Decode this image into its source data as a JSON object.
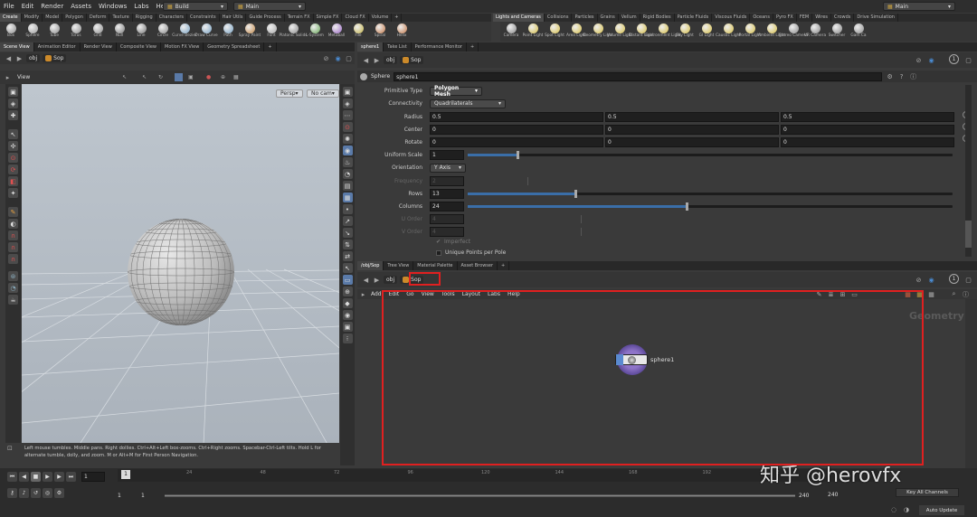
{
  "menubar": {
    "items": [
      "File",
      "Edit",
      "Render",
      "Assets",
      "Windows",
      "Labs",
      "Help"
    ],
    "build_dropdown": "Build",
    "main_dropdown": "Main",
    "main_dropdown_right": "Main"
  },
  "shelf_left": {
    "tabs": [
      "Create",
      "Modify",
      "Model",
      "Polygon",
      "Deform",
      "Texture",
      "Rigging",
      "Characters",
      "Constraints",
      "Hair Utils",
      "Guide Process",
      "Terrain FX",
      "Simple FX",
      "Cloud FX",
      "Volume",
      "+"
    ],
    "tools": [
      {
        "label": "Box",
        "icon": "box-icon",
        "color": "#8d8d8d"
      },
      {
        "label": "Sphere",
        "icon": "sphere-icon",
        "color": "#9c9c9c"
      },
      {
        "label": "Tube",
        "icon": "tube-icon",
        "color": "#8d8d8d"
      },
      {
        "label": "Torus",
        "icon": "torus-icon",
        "color": "#8d8d8d"
      },
      {
        "label": "Grid",
        "icon": "grid-icon",
        "color": "#8d8d8d"
      },
      {
        "label": "Null",
        "icon": "null-icon",
        "color": "#7a7a7a"
      },
      {
        "label": "Line",
        "icon": "line-icon",
        "color": "#7a7a7a"
      },
      {
        "label": "Circle",
        "icon": "circle-icon",
        "color": "#8d8d8d"
      },
      {
        "label": "Curve Bezier",
        "icon": "curve-bezier-icon",
        "color": "#7aa3c4"
      },
      {
        "label": "Draw Curve",
        "icon": "draw-curve-icon",
        "color": "#7aa3c4"
      },
      {
        "label": "Path",
        "icon": "path-icon",
        "color": "#7aa3c4"
      },
      {
        "label": "Spray Paint",
        "icon": "spray-paint-icon",
        "color": "#c48a4a"
      },
      {
        "label": "Font",
        "icon": "font-icon",
        "color": "#aaaaaa"
      },
      {
        "label": "Platonic Solids",
        "icon": "platonic-solids-icon",
        "color": "#8d8d8d"
      },
      {
        "label": "L-System",
        "icon": "l-system-icon",
        "color": "#6aa85a"
      },
      {
        "label": "Metaball",
        "icon": "metaball-icon",
        "color": "#9b6ac4"
      },
      {
        "label": "File",
        "icon": "file-icon",
        "color": "#c4b44a"
      },
      {
        "label": "Spiral",
        "icon": "spiral-icon",
        "color": "#c47a4a"
      },
      {
        "label": "Helix",
        "icon": "helix-icon",
        "color": "#c47a4a"
      }
    ]
  },
  "shelf_right": {
    "tabs": [
      "Lights and Cameras",
      "Collisions",
      "Particles",
      "Grains",
      "Vellum",
      "Rigid Bodies",
      "Particle Fluids",
      "Viscous Fluids",
      "Oceans",
      "Pyro FX",
      "FEM",
      "Wires",
      "Crowds",
      "Drive Simulation"
    ],
    "tools": [
      {
        "label": "Camera",
        "icon": "camera-icon",
        "color": "#8a8a8a"
      },
      {
        "label": "Point Light",
        "icon": "point-light-icon",
        "color": "#d8c04a"
      },
      {
        "label": "Spot Light",
        "icon": "spot-light-icon",
        "color": "#d8c04a"
      },
      {
        "label": "Area Light",
        "icon": "area-light-icon",
        "color": "#d8c04a"
      },
      {
        "label": "Geometry Light",
        "icon": "geometry-light-icon",
        "color": "#d8c04a"
      },
      {
        "label": "Volume Light",
        "icon": "volume-light-icon",
        "color": "#d8c04a"
      },
      {
        "label": "Distant Light",
        "icon": "distant-light-icon",
        "color": "#d8c04a"
      },
      {
        "label": "Environment Light",
        "icon": "environment-light-icon",
        "color": "#d8c04a"
      },
      {
        "label": "Sky Light",
        "icon": "sky-light-icon",
        "color": "#d8c04a"
      },
      {
        "label": "GI Light",
        "icon": "gi-light-icon",
        "color": "#d8c04a"
      },
      {
        "label": "Caustic Light",
        "icon": "caustic-light-icon",
        "color": "#d8c04a"
      },
      {
        "label": "Portal Light",
        "icon": "portal-light-icon",
        "color": "#d8c04a"
      },
      {
        "label": "Ambient Light",
        "icon": "ambient-light-icon",
        "color": "#d8c04a"
      },
      {
        "label": "Stereo Camera",
        "icon": "stereo-camera-icon",
        "color": "#8a8a8a"
      },
      {
        "label": "VR Camera",
        "icon": "vr-camera-icon",
        "color": "#8a8a8a"
      },
      {
        "label": "Switcher",
        "icon": "switcher-icon",
        "color": "#8a8a8a"
      },
      {
        "label": "Gam Ca",
        "icon": "gamepad-camera-icon",
        "color": "#8a8a8a"
      }
    ]
  },
  "left_pane": {
    "tabs": [
      "Scene View",
      "Animation Editor",
      "Render View",
      "Composite View",
      "Motion FX View",
      "Geometry Spreadsheet",
      "+"
    ],
    "path": {
      "root": "obj",
      "node": "Sop"
    },
    "view_label": "View",
    "persp": "Persp",
    "cam": "No cam",
    "hint": "Left mouse tumbles. Middle pans. Right dollies. Ctrl+Alt+Left box-zooms. Ctrl+Right zooms. Spacebar-Ctrl-Left tilts. Hold L for alternate tumble, dolly, and zoom.    M or Alt+M for First Person Navigation."
  },
  "param_pane": {
    "tabs": [
      "sphere1",
      "Take List",
      "Performance Monitor",
      "+"
    ],
    "path": {
      "root": "obj",
      "node": "Sop"
    },
    "node_type": "Sphere",
    "node_name": "sphere1",
    "params": {
      "primitive_type": {
        "label": "Primitive Type",
        "value": "Polygon Mesh"
      },
      "connectivity": {
        "label": "Connectivity",
        "value": "Quadrilaterals"
      },
      "radius": {
        "label": "Radius",
        "values": [
          "0.5",
          "0.5",
          "0.5"
        ]
      },
      "center": {
        "label": "Center",
        "values": [
          "0",
          "0",
          "0"
        ]
      },
      "rotate": {
        "label": "Rotate",
        "values": [
          "0",
          "0",
          "0"
        ]
      },
      "uniform_scale": {
        "label": "Uniform Scale",
        "value": "1",
        "fraction": 0.1
      },
      "orientation": {
        "label": "Orientation",
        "value": "Y Axis"
      },
      "frequency": {
        "label": "Frequency",
        "value": "2"
      },
      "rows": {
        "label": "Rows",
        "value": "13",
        "fraction": 0.22
      },
      "columns": {
        "label": "Columns",
        "value": "24",
        "fraction": 0.45
      },
      "u_order": {
        "label": "U Order",
        "value": "4"
      },
      "v_order": {
        "label": "V Order",
        "value": "4"
      },
      "imperfect": {
        "label": "Imperfect"
      },
      "unique_points": {
        "label": "Unique Points per Pole"
      }
    }
  },
  "network_pane": {
    "tabs": [
      "/obj/Sop",
      "Tree View",
      "Material Palette",
      "Asset Browser",
      "+"
    ],
    "path": {
      "root": "obj",
      "node": "Sop"
    },
    "menu": [
      "Add",
      "Edit",
      "Go",
      "View",
      "Tools",
      "Layout",
      "Labs",
      "Help"
    ],
    "context_label": "Geometry",
    "node_label": "sphere1"
  },
  "timeline": {
    "frame": "1",
    "ticks": [
      "24",
      "48",
      "72",
      "96",
      "120",
      "144",
      "168",
      "192",
      "2"
    ],
    "range_start": "1",
    "range_start2": "1",
    "range_end": "240",
    "range_end2": "240",
    "key_all_channels": "Key All Channels",
    "auto_update": "Auto Update"
  },
  "watermark": "知乎 @herovfx",
  "colors": {
    "accent": "#3a6ea8",
    "highlight": "#e02020",
    "node_ring": "#8e74c8"
  }
}
